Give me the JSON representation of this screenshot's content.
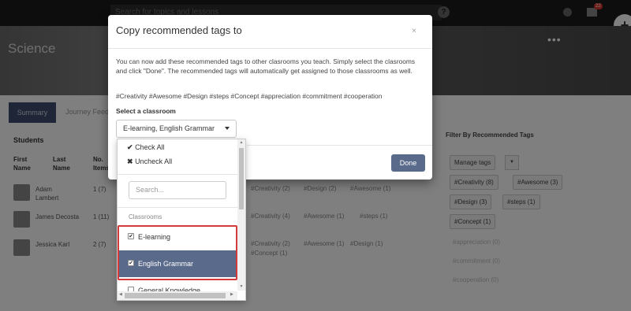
{
  "topbar": {
    "search_placeholder": "Search for topics and lessons",
    "help_icon": "question-icon",
    "notification_count": "22"
  },
  "banner": {
    "title": "Science",
    "menu": "•••"
  },
  "tabs": {
    "summary": "Summary",
    "journey": "Journey Feed"
  },
  "students": {
    "heading": "Students",
    "headers": {
      "first": "First Name",
      "last": "Last Name",
      "no": "No. Items"
    },
    "rows": [
      {
        "first": "Adam",
        "last": "Lambert",
        "count": "1 (7)",
        "tags": [
          "#Creativity (2)",
          "#Design (2)",
          "#Awesome (1)"
        ]
      },
      {
        "first": "James Decosta",
        "last": "",
        "count": "1 (11)",
        "tags": [
          "#Creativity (4)",
          "#Awesome (1)",
          "#steps (1)"
        ]
      },
      {
        "first": "Jessica Karl",
        "last": "",
        "count": "2 (7)",
        "tags": [
          "#Creativity (2)",
          "#Awesome (1)",
          "#Design (1)",
          "#Concept (1)"
        ]
      }
    ]
  },
  "filter": {
    "heading": "Filter By Recommended Tags",
    "manage": "Manage tags",
    "tags": [
      "#Creativity (8)",
      "#Awesome (3)",
      "#Design (3)",
      "#steps (1)",
      "#Concept (1)"
    ],
    "faded": [
      "#appreciation (0)",
      "#commitment (0)",
      "#cooperation (0)"
    ]
  },
  "modal": {
    "title": "Copy recommended tags to",
    "close": "×",
    "description": "You can now add these recommended tags to other clasrooms you teach. Simply select the clasrooms and click \"Done\". The recommended tags will automatically get assigned to those classrooms as well.",
    "tags_line": "#Creativity #Awesome #Design #steps #Concept #appreciation #commitment #cooperation",
    "select_label": "Select a classroom",
    "select_value": "E-learning, English Grammar",
    "done": "Done"
  },
  "dropdown": {
    "check_all": "Check All",
    "uncheck_all": "Uncheck All",
    "search_placeholder": "Search...",
    "group_label": "Classrooms",
    "options": [
      {
        "label": "E-learning",
        "checked": true
      },
      {
        "label": "English Grammar",
        "checked": true
      },
      {
        "label": "General Knowledge",
        "checked": false
      }
    ]
  },
  "colors": {
    "accent": "#5a6a8a",
    "highlight": "#d33a3a",
    "tab_active": "#3e4d6e"
  }
}
